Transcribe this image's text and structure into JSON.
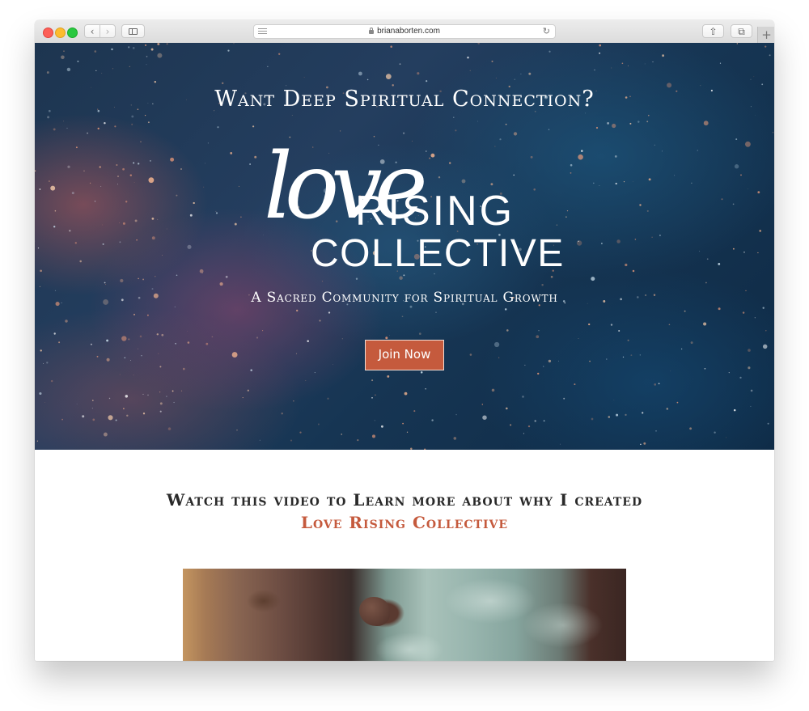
{
  "browser": {
    "url": "brianaborten.com",
    "buttons": {
      "back": "‹",
      "forward": "›",
      "reload": "↻",
      "share": "⇧",
      "tabs": "⧉",
      "new_tab": "+"
    },
    "icons": [
      "close-light",
      "minimize-light",
      "zoom-light",
      "sidebar-icon",
      "reader-icon",
      "lock-icon",
      "reload-icon",
      "share-icon",
      "tabs-icon",
      "plus-icon"
    ]
  },
  "hero": {
    "heading": "Want Deep Spiritual Connection?",
    "logo": {
      "script": "love",
      "line1": "RISING",
      "line2": "COLLECTIVE"
    },
    "tagline": "A Sacred Community for Spiritual Growth",
    "cta_label": "Join Now"
  },
  "video_section": {
    "heading": "Watch this video to Learn more about why I created",
    "heading_accent": "Love Rising Collective"
  },
  "colors": {
    "accent": "#c55a3d",
    "hero_dark_blue": "#163553",
    "heading_text": "#2a2a2a"
  }
}
